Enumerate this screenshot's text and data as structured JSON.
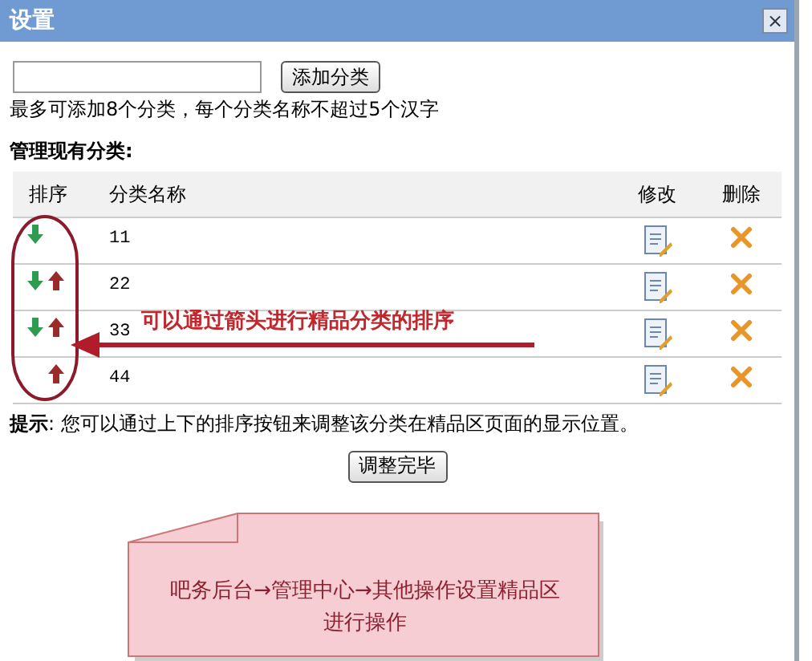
{
  "window": {
    "title": "设置",
    "close": "×"
  },
  "add_form": {
    "button": "添加分类",
    "hint": "最多可添加8个分类，每个分类名称不超过5个汉字"
  },
  "section_title": "管理现有分类:",
  "table": {
    "columns": [
      "排序",
      "分类名称",
      "修改",
      "删除"
    ],
    "rows": [
      {
        "name": "11",
        "down": true,
        "up": false
      },
      {
        "name": "22",
        "down": true,
        "up": true
      },
      {
        "name": "33",
        "down": true,
        "up": true
      },
      {
        "name": "44",
        "down": false,
        "up": true
      }
    ]
  },
  "tip": "**提示**: 您可以通过上下的排序按钮来调整该分类在精品区页面的显示位置。",
  "done_button": "调整完毕",
  "annotation": {
    "text": "可以通过箭头进行精品分类的排序"
  },
  "note": {
    "text": "吧务后台→管理中心→其他操作设置精品区进行操作"
  }
}
